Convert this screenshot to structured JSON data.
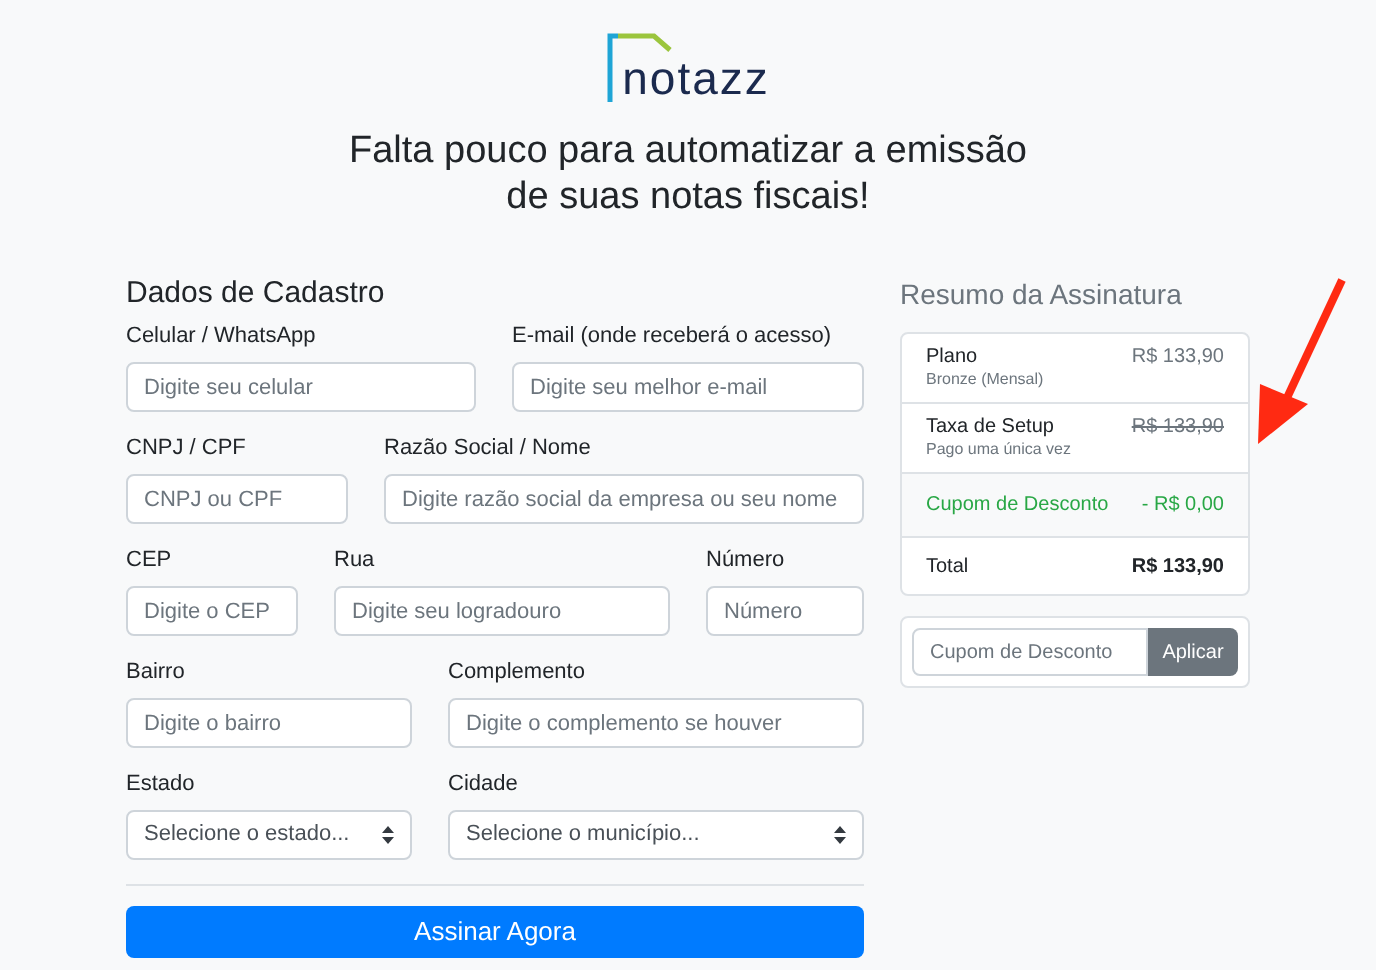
{
  "logo": {
    "text": "notazz"
  },
  "headline": "Falta pouco para automatizar a emissão de suas notas fiscais!",
  "form": {
    "title": "Dados de Cadastro",
    "rows": [
      [
        {
          "label": "Celular / WhatsApp",
          "kind": "input",
          "placeholder": "Digite seu celular"
        },
        {
          "label": "E-mail (onde receberá o acesso)",
          "kind": "input",
          "placeholder": "Digite seu melhor e-mail"
        }
      ],
      [
        {
          "label": "CNPJ / CPF",
          "kind": "input",
          "placeholder": "CNPJ ou CPF"
        },
        {
          "label": "Razão Social / Nome",
          "kind": "input",
          "placeholder": "Digite razão social da empresa ou seu nome"
        }
      ],
      [
        {
          "label": "CEP",
          "kind": "input",
          "placeholder": "Digite o CEP"
        },
        {
          "label": "Rua",
          "kind": "input",
          "placeholder": "Digite seu logradouro"
        },
        {
          "label": "Número",
          "kind": "input",
          "placeholder": "Número"
        }
      ],
      [
        {
          "label": "Bairro",
          "kind": "input",
          "placeholder": "Digite o bairro"
        },
        {
          "label": "Complemento",
          "kind": "input",
          "placeholder": "Digite o complemento se houver"
        }
      ],
      [
        {
          "label": "Estado",
          "kind": "select",
          "value": "Selecione o estado..."
        },
        {
          "label": "Cidade",
          "kind": "select",
          "value": "Selecione o município..."
        }
      ]
    ],
    "submit": "Assinar Agora"
  },
  "summary": {
    "title": "Resumo da Assinatura",
    "items": [
      {
        "kind": "item",
        "name": "Plano",
        "detail": "Bronze (Mensal)",
        "price": "R$ 133,90",
        "struck": false
      },
      {
        "kind": "item",
        "name": "Taxa de Setup",
        "detail": "Pago uma única vez",
        "price": "R$ 133,90",
        "struck": true
      },
      {
        "kind": "discount",
        "name": "Cupom de Desconto",
        "price": "- R$ 0,00"
      },
      {
        "kind": "total",
        "name": "Total",
        "price": "R$ 133,90"
      }
    ],
    "coupon": {
      "placeholder": "Cupom de Desconto",
      "button": "Aplicar"
    }
  }
}
